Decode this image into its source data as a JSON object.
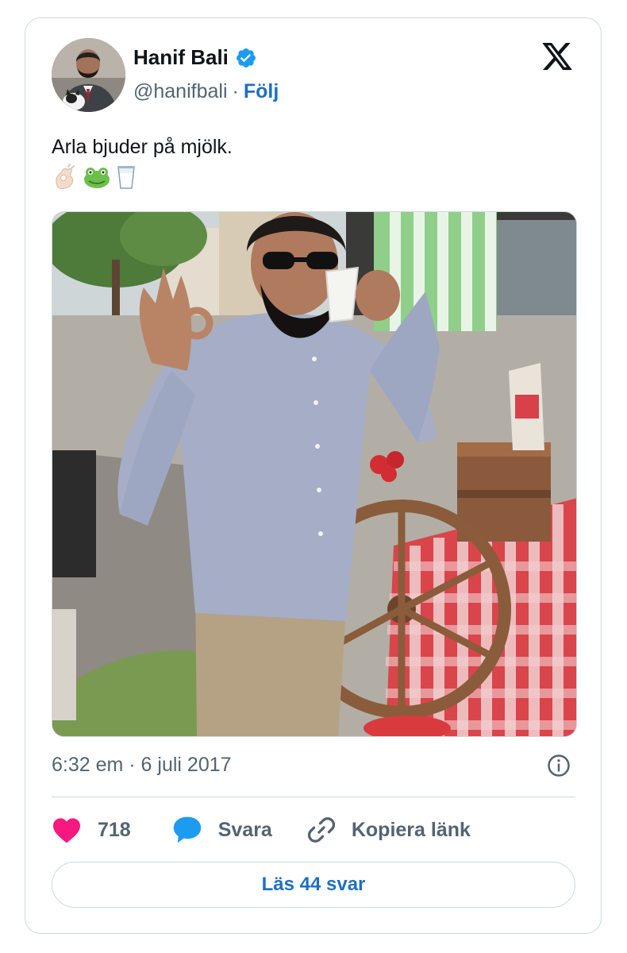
{
  "author": {
    "name": "Hanif Bali",
    "handle": "@hanifbali",
    "separator": "·",
    "follow_label": "Följ",
    "verified": true,
    "avatar_icon": "profile-avatar-photo"
  },
  "tweet": {
    "text": "Arla bjuder på mjölk.",
    "emojis": [
      "ok-hand-emoji",
      "frog-emoji",
      "milk-glass-emoji"
    ],
    "media_description_icon": "tweet-photo"
  },
  "meta": {
    "timestamp": "6:32 em · 6 juli 2017"
  },
  "actions": {
    "like_count": "718",
    "reply_label": "Svara",
    "copy_label": "Kopiera länk"
  },
  "read_replies_label": "Läs 44 svar",
  "colors": {
    "like": "#f91880",
    "reply": "#1d9bf0",
    "follow": "#1d6fc4",
    "verified": "#1d9bf0",
    "border": "#cfd9de",
    "muted": "#536471"
  }
}
